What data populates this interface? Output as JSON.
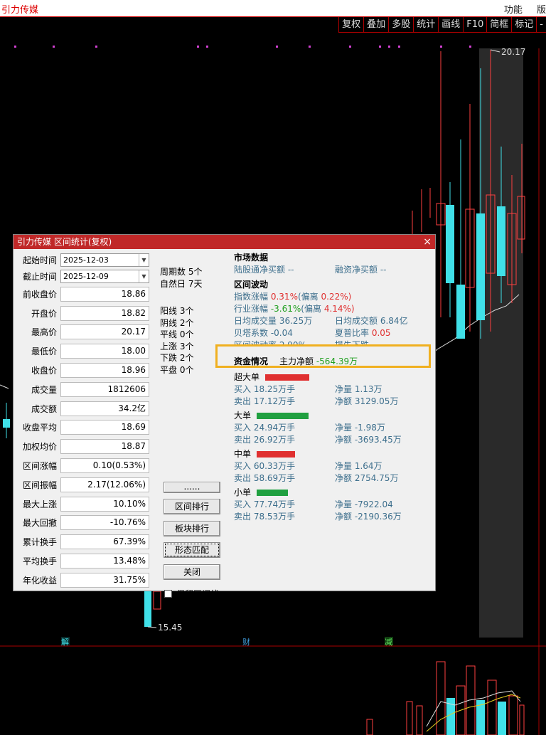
{
  "topbar": {
    "stock_name": "引力传媒",
    "menu": [
      "功能",
      "版"
    ]
  },
  "toolbar": [
    "复权",
    "叠加",
    "多股",
    "统计",
    "画线",
    "F10",
    "简框",
    "标记",
    "-"
  ],
  "chart": {
    "high_label": "20.17",
    "low_label": "15.45",
    "markers": [
      "解",
      "财",
      "减"
    ],
    "colors": {
      "up": "#ff4040",
      "down": "#40e0e8",
      "ma": "#e0e0e0",
      "volume_ma": "#e8d020"
    }
  },
  "dialog": {
    "title": "引力传媒 区间统计(复权)",
    "close": "×",
    "start_label": "起始时间",
    "start_value": "2025-12-03",
    "end_label": "截止时间",
    "end_value": "2025-12-09",
    "fields": [
      {
        "label": "前收盘价",
        "value": "18.86"
      },
      {
        "label": "开盘价",
        "value": "18.82"
      },
      {
        "label": "最高价",
        "value": "20.17"
      },
      {
        "label": "最低价",
        "value": "18.00"
      },
      {
        "label": "收盘价",
        "value": "18.96"
      },
      {
        "label": "成交量",
        "value": "1812606"
      },
      {
        "label": "成交额",
        "value": "34.2亿"
      },
      {
        "label": "收盘平均",
        "value": "18.69"
      },
      {
        "label": "加权均价",
        "value": "18.87"
      },
      {
        "label": "区间涨幅",
        "value": "0.10(0.53%)"
      },
      {
        "label": "区间振幅",
        "value": "2.17(12.06%)"
      },
      {
        "label": "最大上涨",
        "value": "10.10%"
      },
      {
        "label": "最大回撤",
        "value": "-10.76%"
      },
      {
        "label": "累计换手",
        "value": "67.39%"
      },
      {
        "label": "平均换手",
        "value": "13.48%"
      },
      {
        "label": "年化收益",
        "value": "31.75%"
      }
    ],
    "period": [
      "周期数 5个",
      "自然日 7天"
    ],
    "candles": [
      "阳线 3个",
      "阴线 2个",
      "平线 0个",
      "上涨 3个",
      "下跌 2个",
      "平盘 0个"
    ],
    "buttons": {
      "more": "......",
      "rank": "区间排行",
      "sector_rank": "板块排行",
      "pattern": "形态匹配",
      "close": "关闭"
    },
    "keep_line": "保留区间线",
    "market": {
      "title": "市场数据",
      "hk_label": "陆股通净买额",
      "hk_value": "--",
      "margin_label": "融资净买额",
      "margin_value": "--"
    },
    "volatility": {
      "title": "区间波动",
      "index_label": "指数涨幅",
      "index_value": "0.31%",
      "index_dev_label": "(偏离",
      "index_dev_value": "0.22%)",
      "industry_label": "行业涨幅",
      "industry_value": "-3.61%",
      "industry_dev_label": "(偏离",
      "industry_dev_value": "4.14%)",
      "avg_vol_label": "日均成交量",
      "avg_vol_value": "36.25万",
      "avg_amt_label": "日均成交额",
      "avg_amt_value": "6.84亿",
      "beta_label": "贝塔系数",
      "beta_value": "-0.04",
      "sharpe_label": "夏普比率",
      "sharpe_value": "0.05",
      "fluct_label": "区间波动率",
      "fluct_value": "2.90%",
      "trend_label": "损失下跌"
    },
    "capital": {
      "title": "资金情况",
      "main_label": "主力净额",
      "main_value": "-564.39万",
      "groups": [
        {
          "title": "超大单",
          "color": "#e03030",
          "bar": 0.55,
          "buy": "买入 18.25万手",
          "sell": "卖出 17.12万手",
          "net_vol": "净量 1.13万",
          "net_amt": "净额 3129.05万"
        },
        {
          "title": "大单",
          "color": "#20a040",
          "bar": 0.65,
          "buy": "买入 24.94万手",
          "sell": "卖出 26.92万手",
          "net_vol": "净量 -1.98万",
          "net_amt": "净额 -3693.45万"
        },
        {
          "title": "中单",
          "color": "#e03030",
          "bar": 0.48,
          "buy": "买入 60.33万手",
          "sell": "卖出 58.69万手",
          "net_vol": "净量 1.64万",
          "net_amt": "净额 2754.75万"
        },
        {
          "title": "小单",
          "color": "#20a040",
          "bar": 0.39,
          "buy": "买入 77.74万手",
          "sell": "卖出 78.53万手",
          "net_vol": "净量 -7922.04",
          "net_amt": "净额 -2190.36万"
        }
      ]
    }
  }
}
